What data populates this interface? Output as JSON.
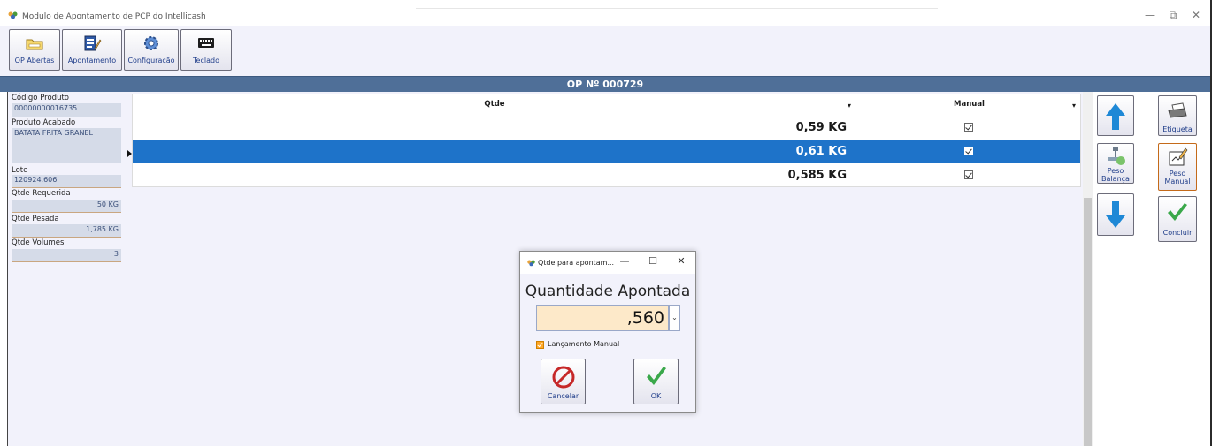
{
  "window": {
    "title": "Modulo de Apontamento de PCP do Intellicash",
    "minimize_glyph": "—",
    "restore_glyph": "⧉",
    "close_glyph": "✕"
  },
  "toolbar": {
    "buttons": [
      {
        "label": "OP Abertas",
        "icon": "folder-icon"
      },
      {
        "label": "Apontamento",
        "icon": "notepad-pencil-icon"
      },
      {
        "label": "Configuração",
        "icon": "gear-icon"
      },
      {
        "label": "Teclado",
        "icon": "keyboard-icon"
      }
    ]
  },
  "op": {
    "title": "OP Nº 000729"
  },
  "fields": {
    "codigo_label": "Código Produto",
    "codigo_value": "00000000016735",
    "produto_label": "Produto Acabado",
    "produto_value": "BATATA FRITA GRANEL",
    "lote_label": "Lote",
    "lote_value": "120924.606",
    "qtde_requerida_label": "Qtde Requerida",
    "qtde_requerida_value": "50 KG",
    "qtde_pesada_label": "Qtde Pesada",
    "qtde_pesada_value": "1,785 KG",
    "qtde_volumes_label": "Qtde Volumes",
    "qtde_volumes_value": "3"
  },
  "grid": {
    "columns": [
      "Qtde",
      "Manual"
    ],
    "rows": [
      {
        "qtde": "0,59 KG",
        "manual": true,
        "selected": false
      },
      {
        "qtde": "0,61 KG",
        "manual": true,
        "selected": true
      },
      {
        "qtde": "0,585 KG",
        "manual": true,
        "selected": false
      }
    ]
  },
  "side": {
    "etiqueta": "Etiqueta",
    "peso_balanca": "Peso Balança",
    "peso_manual": "Peso Manual",
    "concluir": "Concluir"
  },
  "dialog": {
    "title": "Qtde para apontam...",
    "heading": "Quantidade Apontada",
    "value": ",560",
    "checkbox_label": "Lançamento Manual",
    "checkbox_checked": true,
    "cancel_label": "Cancelar",
    "ok_label": "OK"
  },
  "colors": {
    "accent": "#1e73c9",
    "header_bar": "#4f6f98",
    "panel_bg": "#f2f2fb",
    "field_bg": "#d5dbe8",
    "input_bg": "#fde9c9"
  }
}
